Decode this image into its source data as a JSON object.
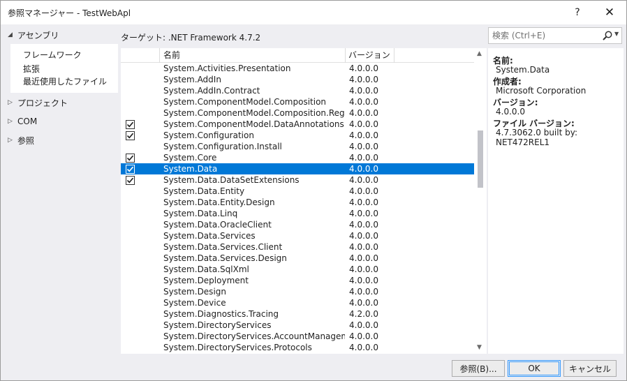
{
  "window": {
    "title": "参照マネージャー - TestWebApl",
    "help_glyph": "?",
    "close_glyph": "✕"
  },
  "nav": {
    "assemblies": "アセンブリ",
    "assemblies_sub": [
      "フレームワーク",
      "拡張",
      "最近使用したファイル"
    ],
    "project": "プロジェクト",
    "com": "COM",
    "browse": "参照"
  },
  "target": "ターゲット: .NET Framework 4.7.2",
  "search": {
    "placeholder": "検索 (Ctrl+E)"
  },
  "list": {
    "header_name": "名前",
    "header_version": "バージョン",
    "rows": [
      {
        "name": "System.Activities.Presentation",
        "version": "4.0.0.0",
        "checked": false,
        "selected": false
      },
      {
        "name": "System.AddIn",
        "version": "4.0.0.0",
        "checked": false,
        "selected": false
      },
      {
        "name": "System.AddIn.Contract",
        "version": "4.0.0.0",
        "checked": false,
        "selected": false
      },
      {
        "name": "System.ComponentModel.Composition",
        "version": "4.0.0.0",
        "checked": false,
        "selected": false
      },
      {
        "name": "System.ComponentModel.Composition.Registr…",
        "version": "4.0.0.0",
        "checked": false,
        "selected": false
      },
      {
        "name": "System.ComponentModel.DataAnnotations",
        "version": "4.0.0.0",
        "checked": true,
        "selected": false
      },
      {
        "name": "System.Configuration",
        "version": "4.0.0.0",
        "checked": true,
        "selected": false
      },
      {
        "name": "System.Configuration.Install",
        "version": "4.0.0.0",
        "checked": false,
        "selected": false
      },
      {
        "name": "System.Core",
        "version": "4.0.0.0",
        "checked": true,
        "selected": false
      },
      {
        "name": "System.Data",
        "version": "4.0.0.0",
        "checked": true,
        "selected": true
      },
      {
        "name": "System.Data.DataSetExtensions",
        "version": "4.0.0.0",
        "checked": true,
        "selected": false
      },
      {
        "name": "System.Data.Entity",
        "version": "4.0.0.0",
        "checked": false,
        "selected": false
      },
      {
        "name": "System.Data.Entity.Design",
        "version": "4.0.0.0",
        "checked": false,
        "selected": false
      },
      {
        "name": "System.Data.Linq",
        "version": "4.0.0.0",
        "checked": false,
        "selected": false
      },
      {
        "name": "System.Data.OracleClient",
        "version": "4.0.0.0",
        "checked": false,
        "selected": false
      },
      {
        "name": "System.Data.Services",
        "version": "4.0.0.0",
        "checked": false,
        "selected": false
      },
      {
        "name": "System.Data.Services.Client",
        "version": "4.0.0.0",
        "checked": false,
        "selected": false
      },
      {
        "name": "System.Data.Services.Design",
        "version": "4.0.0.0",
        "checked": false,
        "selected": false
      },
      {
        "name": "System.Data.SqlXml",
        "version": "4.0.0.0",
        "checked": false,
        "selected": false
      },
      {
        "name": "System.Deployment",
        "version": "4.0.0.0",
        "checked": false,
        "selected": false
      },
      {
        "name": "System.Design",
        "version": "4.0.0.0",
        "checked": false,
        "selected": false
      },
      {
        "name": "System.Device",
        "version": "4.0.0.0",
        "checked": false,
        "selected": false
      },
      {
        "name": "System.Diagnostics.Tracing",
        "version": "4.2.0.0",
        "checked": false,
        "selected": false
      },
      {
        "name": "System.DirectoryServices",
        "version": "4.0.0.0",
        "checked": false,
        "selected": false
      },
      {
        "name": "System.DirectoryServices.AccountManagement",
        "version": "4.0.0.0",
        "checked": false,
        "selected": false
      },
      {
        "name": "System.DirectoryServices.Protocols",
        "version": "4.0.0.0",
        "checked": false,
        "selected": false
      }
    ]
  },
  "details": {
    "name_label": "名前:",
    "name_value": "System.Data",
    "author_label": "作成者:",
    "author_value": "Microsoft Corporation",
    "version_label": "バージョン:",
    "version_value": "4.0.0.0",
    "file_version_label": "ファイル バージョン:",
    "file_version_value": "4.7.3062.0 built by: NET472REL1"
  },
  "buttons": {
    "browse": "参照(B)...",
    "ok": "OK",
    "cancel": "キャンセル"
  },
  "colors": {
    "selection": "#0078d7",
    "primary_border": "#3399ff"
  }
}
